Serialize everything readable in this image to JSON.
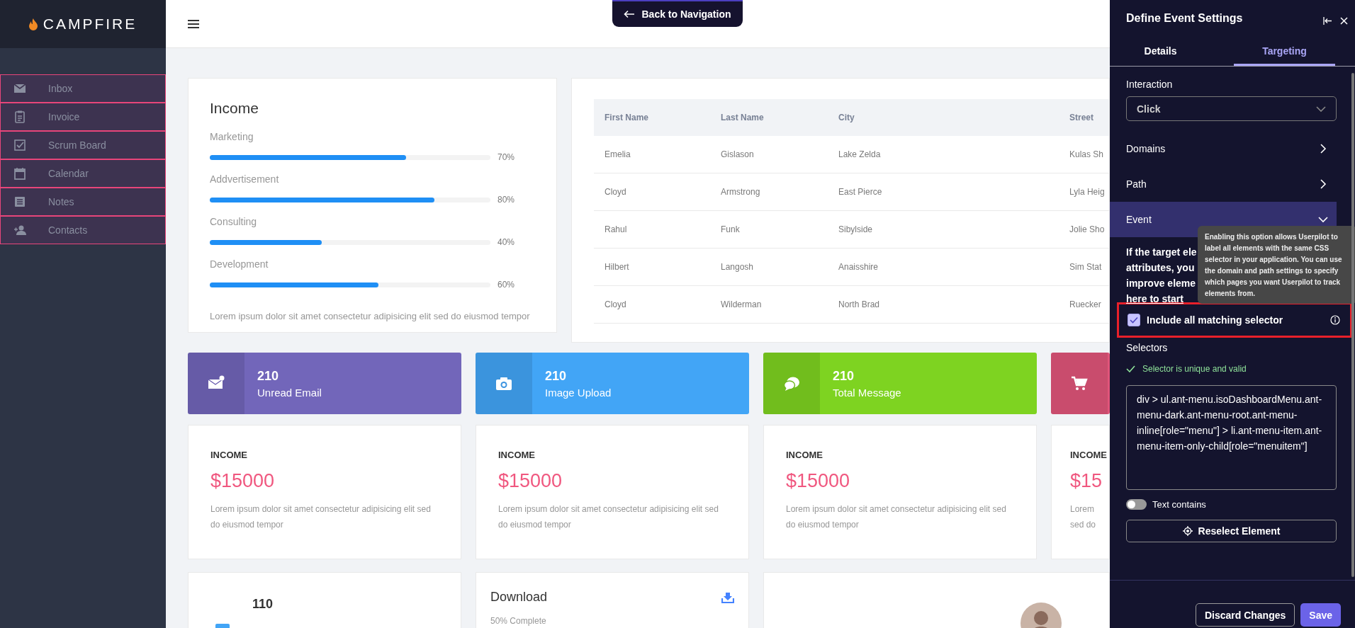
{
  "sidebar": {
    "logo": "CAMPFIRE",
    "items": [
      {
        "label": "Inbox",
        "highlighted": true
      },
      {
        "label": "Invoice",
        "highlighted": true
      },
      {
        "label": "Scrum Board",
        "highlighted": true
      },
      {
        "label": "Calendar",
        "highlighted": true
      },
      {
        "label": "Notes",
        "highlighted": true
      },
      {
        "label": "Contacts",
        "highlighted": true
      }
    ]
  },
  "topbar": {
    "back_button": "Back to Navigation"
  },
  "income": {
    "title": "Income",
    "bars": [
      {
        "label": "Marketing",
        "level": 0.7,
        "reading": "70%"
      },
      {
        "label": "Addvertisement",
        "level": 0.8,
        "reading": "80%"
      },
      {
        "label": "Consulting",
        "level": 0.4,
        "reading": "40%"
      },
      {
        "label": "Development",
        "level": 0.6,
        "reading": "60%"
      }
    ],
    "note": "Lorem ipsum dolor sit amet consectetur adipisicing elit sed do eiusmod tempor"
  },
  "table": {
    "columns": [
      "First Name",
      "Last Name",
      "City",
      "Street"
    ],
    "rows": [
      [
        "Emelia",
        "Gislason",
        "Lake Zelda",
        "Kulas Sh"
      ],
      [
        "Cloyd",
        "Armstrong",
        "East Pierce",
        "Lyla Heig"
      ],
      [
        "Rahul",
        "Funk",
        "Sibylside",
        "Jolie Sho"
      ],
      [
        "Hilbert",
        "Langosh",
        "Anaisshire",
        "Sim Stat"
      ],
      [
        "Cloyd",
        "Wilderman",
        "North Brad",
        "Ruecker"
      ]
    ]
  },
  "tiles": [
    {
      "count": "210",
      "label": "Unread Email",
      "color": "#7266ba"
    },
    {
      "count": "210",
      "label": "Image Upload",
      "color": "#42a5f6"
    },
    {
      "count": "210",
      "label": "Total Message",
      "color": "#7ed321"
    },
    {
      "color": "#e0557a"
    }
  ],
  "income_cards": [
    {
      "title": "INCOME",
      "amount": "$15000",
      "text": "Lorem ipsum dolor sit amet consectetur adipisicing elit sed do eiusmod tempor"
    },
    {
      "title": "INCOME",
      "amount": "$15000",
      "text": "Lorem ipsum dolor sit amet consectetur adipisicing elit sed do eiusmod tempor"
    },
    {
      "title": "INCOME",
      "amount": "$15000",
      "text": "Lorem ipsum dolor sit amet consectetur adipisicing elit sed do eiusmod tempor"
    },
    {
      "title": "INCOME",
      "amount": "$15",
      "text": "Lorem sed do"
    }
  ],
  "bottom_cards": [
    {
      "kind": "stat",
      "count": "110"
    },
    {
      "kind": "download",
      "title": "Download",
      "caption": "50% Complete"
    },
    {
      "kind": "profile"
    }
  ],
  "panel": {
    "title": "Define Event Settings",
    "tabs": [
      {
        "label": "Details",
        "selected": false
      },
      {
        "label": "Targeting",
        "selected": true
      }
    ],
    "interaction": {
      "label": "Interaction",
      "value": "Click"
    },
    "sections": [
      {
        "label": "Domains",
        "expanded": false
      },
      {
        "label": "Path",
        "expanded": false
      },
      {
        "label": "Event",
        "expanded": true
      }
    ],
    "event_help": {
      "lines": [
        "If the target ele",
        "attributes, you",
        "improve eleme"
      ],
      "link": "here to start"
    },
    "tooltip": "Enabling this option allows Userpilot to label all elements with the same CSS selector in your application. You can use the domain and path settings to specify which pages you want Userpilot to track elements from.",
    "include_matching": {
      "label": "Include all matching selector",
      "checked": true,
      "highlighted": true
    },
    "selectors": {
      "label": "Selectors",
      "status": "Selector is unique and valid",
      "value": "div > ul.ant-menu.isoDashboardMenu.ant-menu-dark.ant-menu-root.ant-menu-inline[role=\"menu\"] > li.ant-menu-item.ant-menu-item-only-child[role=\"menuitem\"]"
    },
    "text_contains": {
      "label": "Text contains",
      "on": false
    },
    "reselect": "Reselect Element",
    "buttons": [
      {
        "label": "Discard Changes",
        "kind": "secondary"
      },
      {
        "label": "Save",
        "kind": "primary"
      }
    ]
  }
}
